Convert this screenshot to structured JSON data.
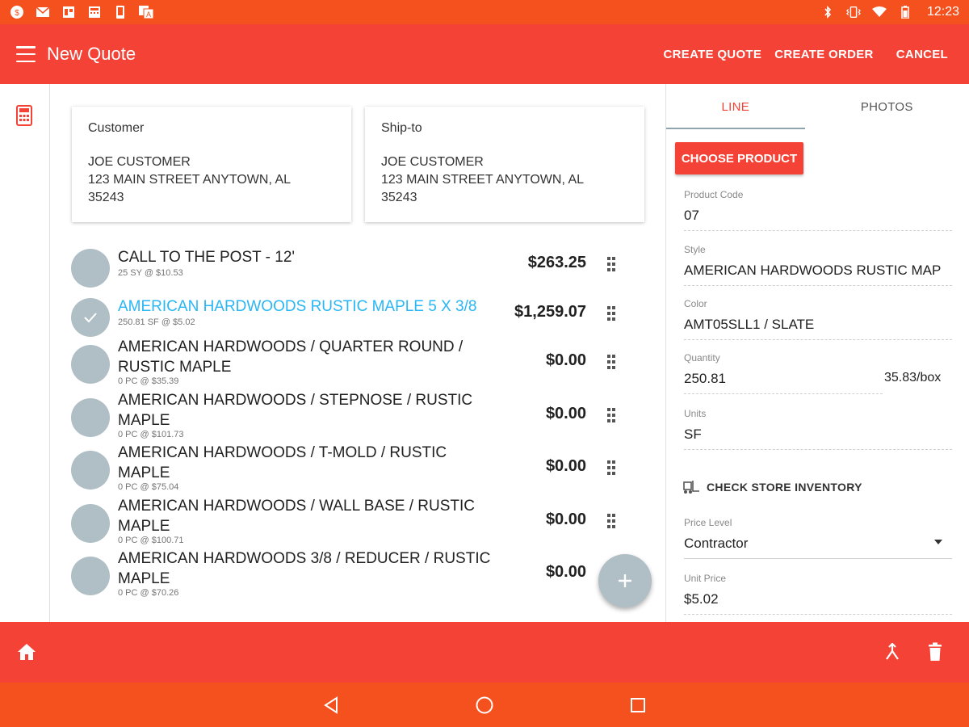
{
  "status_bar": {
    "time": "12:23"
  },
  "app_bar": {
    "title": "New Quote",
    "actions": {
      "create_quote": "CREATE QUOTE",
      "create_order": "CREATE ORDER",
      "cancel": "CANCEL"
    }
  },
  "customer_card": {
    "title": "Customer",
    "lines": [
      "JOE CUSTOMER",
      "123 MAIN STREET ANYTOWN, AL",
      "35243"
    ]
  },
  "shipto_card": {
    "title": "Ship-to",
    "lines": [
      "JOE CUSTOMER",
      "123 MAIN STREET ANYTOWN, AL",
      "35243"
    ]
  },
  "line_items": [
    {
      "name": "CALL TO THE POST - 12'",
      "sub": "25 SY @ $10.53",
      "price": "$263.25",
      "selected": false
    },
    {
      "name": "AMERICAN HARDWOODS RUSTIC MAPLE 5 X 3/8",
      "sub": "250.81 SF @ $5.02",
      "price": "$1,259.07",
      "selected": true
    },
    {
      "name": "AMERICAN HARDWOODS / QUARTER ROUND / RUSTIC MAPLE",
      "sub": "0 PC @ $35.39",
      "price": "$0.00",
      "selected": false
    },
    {
      "name": "AMERICAN HARDWOODS / STEPNOSE / RUSTIC MAPLE",
      "sub": "0 PC @ $101.73",
      "price": "$0.00",
      "selected": false
    },
    {
      "name": "AMERICAN HARDWOODS / T-MOLD / RUSTIC MAPLE",
      "sub": "0 PC @ $75.04",
      "price": "$0.00",
      "selected": false
    },
    {
      "name": "AMERICAN HARDWOODS / WALL BASE / RUSTIC MAPLE",
      "sub": "0 PC @ $100.71",
      "price": "$0.00",
      "selected": false
    },
    {
      "name": "AMERICAN HARDWOODS 3/8 / REDUCER / RUSTIC MAPLE",
      "sub": "0 PC @ $70.26",
      "price": "$0.00",
      "selected": false
    }
  ],
  "panel": {
    "tabs": {
      "line": "LINE",
      "photos": "PHOTOS"
    },
    "choose_product": "CHOOSE PRODUCT",
    "product_code": {
      "label": "Product Code",
      "value": "07"
    },
    "style": {
      "label": "Style",
      "value": "AMERICAN HARDWOODS RUSTIC MAP"
    },
    "color": {
      "label": "Color",
      "value": "AMT05SLL1 / SLATE"
    },
    "quantity": {
      "label": "Quantity",
      "value": "250.81",
      "per_box": "35.83/box"
    },
    "units": {
      "label": "Units",
      "value": "SF"
    },
    "check_inventory": "CHECK STORE INVENTORY",
    "price_level": {
      "label": "Price Level",
      "value": "Contractor"
    },
    "unit_price": {
      "label": "Unit Price",
      "value": "$5.02"
    }
  },
  "colors": {
    "primary": "#f44336",
    "status": "#f4511e",
    "avatar": "#b0bec5",
    "selected_text": "#29b6f6"
  }
}
